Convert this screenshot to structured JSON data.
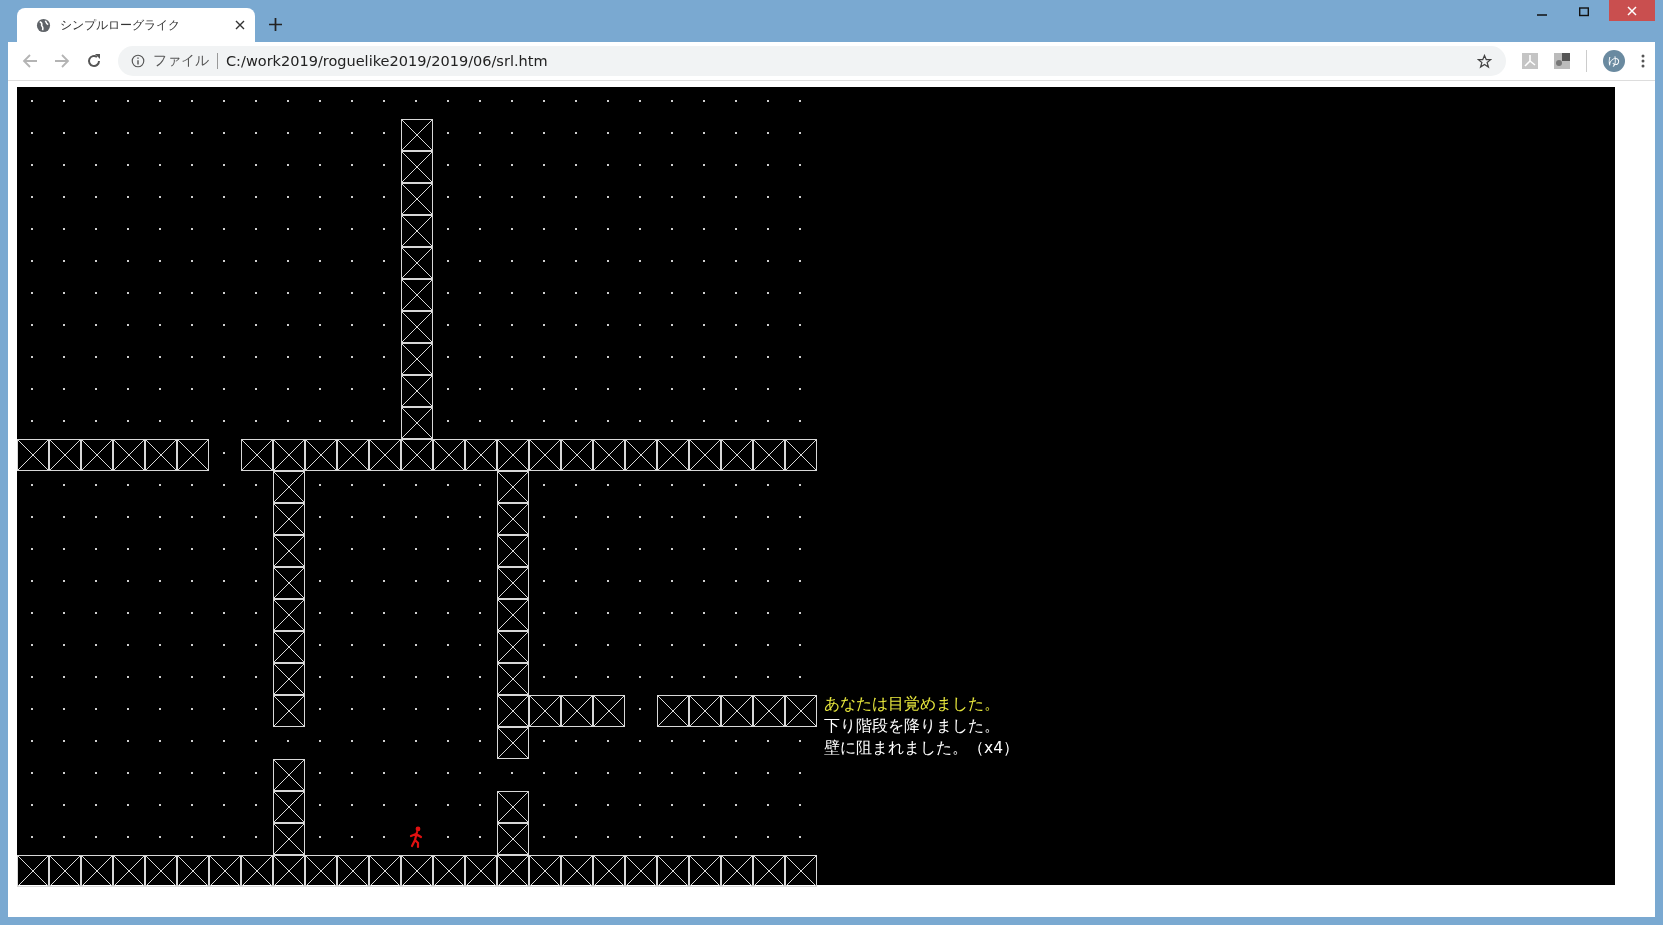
{
  "browser": {
    "tab": {
      "title": "シンプルローグライク"
    },
    "address": {
      "scheme": "ファイル",
      "url": "C:/work2019/roguelike2019/2019/06/srl.htm"
    },
    "avatar": "ゆ"
  },
  "map": {
    "rows": [
      [
        {
          "kind": "floor"
        },
        {
          "kind": "floor"
        },
        {
          "kind": "floor"
        },
        {
          "kind": "floor"
        },
        {
          "kind": "floor"
        },
        {
          "kind": "floor"
        },
        {
          "kind": "floor"
        },
        {
          "kind": "floor"
        },
        {
          "kind": "floor"
        },
        {
          "kind": "floor"
        },
        {
          "kind": "floor"
        },
        {
          "kind": "floor"
        },
        {
          "kind": "floor"
        },
        {
          "kind": "floor"
        },
        {
          "kind": "floor"
        },
        {
          "kind": "floor"
        },
        {
          "kind": "floor"
        },
        {
          "kind": "floor"
        },
        {
          "kind": "floor"
        },
        {
          "kind": "floor"
        },
        {
          "kind": "floor"
        },
        {
          "kind": "floor"
        },
        {
          "kind": "floor"
        },
        {
          "kind": "floor"
        },
        {
          "kind": "floor"
        }
      ],
      [
        {
          "kind": "floor"
        },
        {
          "kind": "floor"
        },
        {
          "kind": "floor"
        },
        {
          "kind": "floor"
        },
        {
          "kind": "floor"
        },
        {
          "kind": "floor"
        },
        {
          "kind": "floor"
        },
        {
          "kind": "floor"
        },
        {
          "kind": "floor"
        },
        {
          "kind": "floor"
        },
        {
          "kind": "floor"
        },
        {
          "kind": "floor"
        },
        {
          "kind": "wall"
        },
        {
          "kind": "floor"
        },
        {
          "kind": "floor"
        },
        {
          "kind": "floor"
        },
        {
          "kind": "floor"
        },
        {
          "kind": "floor"
        },
        {
          "kind": "floor"
        },
        {
          "kind": "floor"
        },
        {
          "kind": "floor"
        },
        {
          "kind": "floor"
        },
        {
          "kind": "floor"
        },
        {
          "kind": "floor"
        },
        {
          "kind": "floor"
        }
      ],
      [
        {
          "kind": "floor"
        },
        {
          "kind": "floor"
        },
        {
          "kind": "floor"
        },
        {
          "kind": "floor"
        },
        {
          "kind": "floor"
        },
        {
          "kind": "floor"
        },
        {
          "kind": "floor"
        },
        {
          "kind": "floor"
        },
        {
          "kind": "floor"
        },
        {
          "kind": "floor"
        },
        {
          "kind": "floor"
        },
        {
          "kind": "floor"
        },
        {
          "kind": "wall"
        },
        {
          "kind": "floor"
        },
        {
          "kind": "floor"
        },
        {
          "kind": "floor"
        },
        {
          "kind": "floor"
        },
        {
          "kind": "floor"
        },
        {
          "kind": "floor"
        },
        {
          "kind": "floor"
        },
        {
          "kind": "floor"
        },
        {
          "kind": "floor"
        },
        {
          "kind": "floor"
        },
        {
          "kind": "floor"
        },
        {
          "kind": "floor"
        }
      ],
      [
        {
          "kind": "floor"
        },
        {
          "kind": "floor"
        },
        {
          "kind": "floor"
        },
        {
          "kind": "floor"
        },
        {
          "kind": "floor"
        },
        {
          "kind": "floor"
        },
        {
          "kind": "floor"
        },
        {
          "kind": "floor"
        },
        {
          "kind": "floor"
        },
        {
          "kind": "floor"
        },
        {
          "kind": "floor"
        },
        {
          "kind": "floor"
        },
        {
          "kind": "wall"
        },
        {
          "kind": "floor"
        },
        {
          "kind": "floor"
        },
        {
          "kind": "floor"
        },
        {
          "kind": "floor"
        },
        {
          "kind": "floor"
        },
        {
          "kind": "floor"
        },
        {
          "kind": "floor"
        },
        {
          "kind": "floor"
        },
        {
          "kind": "floor"
        },
        {
          "kind": "floor"
        },
        {
          "kind": "floor"
        },
        {
          "kind": "floor"
        }
      ],
      [
        {
          "kind": "floor"
        },
        {
          "kind": "floor"
        },
        {
          "kind": "floor"
        },
        {
          "kind": "floor"
        },
        {
          "kind": "floor"
        },
        {
          "kind": "floor"
        },
        {
          "kind": "floor"
        },
        {
          "kind": "floor"
        },
        {
          "kind": "floor"
        },
        {
          "kind": "floor"
        },
        {
          "kind": "floor"
        },
        {
          "kind": "floor"
        },
        {
          "kind": "wall"
        },
        {
          "kind": "floor"
        },
        {
          "kind": "floor"
        },
        {
          "kind": "floor"
        },
        {
          "kind": "floor"
        },
        {
          "kind": "floor"
        },
        {
          "kind": "floor"
        },
        {
          "kind": "floor"
        },
        {
          "kind": "floor"
        },
        {
          "kind": "floor"
        },
        {
          "kind": "floor"
        },
        {
          "kind": "floor"
        },
        {
          "kind": "floor"
        }
      ],
      [
        {
          "kind": "floor"
        },
        {
          "kind": "floor"
        },
        {
          "kind": "floor"
        },
        {
          "kind": "floor"
        },
        {
          "kind": "floor"
        },
        {
          "kind": "floor"
        },
        {
          "kind": "floor"
        },
        {
          "kind": "floor"
        },
        {
          "kind": "floor"
        },
        {
          "kind": "floor"
        },
        {
          "kind": "floor"
        },
        {
          "kind": "floor"
        },
        {
          "kind": "wall"
        },
        {
          "kind": "floor"
        },
        {
          "kind": "floor"
        },
        {
          "kind": "floor"
        },
        {
          "kind": "floor"
        },
        {
          "kind": "floor"
        },
        {
          "kind": "floor"
        },
        {
          "kind": "floor"
        },
        {
          "kind": "floor"
        },
        {
          "kind": "floor"
        },
        {
          "kind": "floor"
        },
        {
          "kind": "floor"
        },
        {
          "kind": "floor"
        }
      ],
      [
        {
          "kind": "floor"
        },
        {
          "kind": "floor"
        },
        {
          "kind": "floor"
        },
        {
          "kind": "floor"
        },
        {
          "kind": "floor"
        },
        {
          "kind": "floor"
        },
        {
          "kind": "floor"
        },
        {
          "kind": "floor"
        },
        {
          "kind": "floor"
        },
        {
          "kind": "floor"
        },
        {
          "kind": "floor"
        },
        {
          "kind": "floor"
        },
        {
          "kind": "wall"
        },
        {
          "kind": "floor"
        },
        {
          "kind": "floor"
        },
        {
          "kind": "floor"
        },
        {
          "kind": "floor"
        },
        {
          "kind": "floor"
        },
        {
          "kind": "floor"
        },
        {
          "kind": "floor"
        },
        {
          "kind": "floor"
        },
        {
          "kind": "floor"
        },
        {
          "kind": "floor"
        },
        {
          "kind": "floor"
        },
        {
          "kind": "floor"
        }
      ],
      [
        {
          "kind": "floor"
        },
        {
          "kind": "floor"
        },
        {
          "kind": "floor"
        },
        {
          "kind": "floor"
        },
        {
          "kind": "floor"
        },
        {
          "kind": "floor"
        },
        {
          "kind": "floor"
        },
        {
          "kind": "floor"
        },
        {
          "kind": "floor"
        },
        {
          "kind": "floor"
        },
        {
          "kind": "floor"
        },
        {
          "kind": "floor"
        },
        {
          "kind": "wall"
        },
        {
          "kind": "floor"
        },
        {
          "kind": "floor"
        },
        {
          "kind": "floor"
        },
        {
          "kind": "floor"
        },
        {
          "kind": "floor"
        },
        {
          "kind": "floor"
        },
        {
          "kind": "floor"
        },
        {
          "kind": "floor"
        },
        {
          "kind": "floor"
        },
        {
          "kind": "floor"
        },
        {
          "kind": "floor"
        },
        {
          "kind": "floor"
        }
      ],
      [
        {
          "kind": "floor"
        },
        {
          "kind": "floor"
        },
        {
          "kind": "floor"
        },
        {
          "kind": "floor"
        },
        {
          "kind": "floor"
        },
        {
          "kind": "floor"
        },
        {
          "kind": "floor"
        },
        {
          "kind": "floor"
        },
        {
          "kind": "floor"
        },
        {
          "kind": "floor"
        },
        {
          "kind": "floor"
        },
        {
          "kind": "floor"
        },
        {
          "kind": "wall"
        },
        {
          "kind": "floor"
        },
        {
          "kind": "floor"
        },
        {
          "kind": "floor"
        },
        {
          "kind": "floor"
        },
        {
          "kind": "floor"
        },
        {
          "kind": "floor"
        },
        {
          "kind": "floor"
        },
        {
          "kind": "floor"
        },
        {
          "kind": "floor"
        },
        {
          "kind": "floor"
        },
        {
          "kind": "floor"
        },
        {
          "kind": "floor"
        }
      ],
      [
        {
          "kind": "floor"
        },
        {
          "kind": "floor"
        },
        {
          "kind": "floor"
        },
        {
          "kind": "floor"
        },
        {
          "kind": "floor"
        },
        {
          "kind": "floor"
        },
        {
          "kind": "floor"
        },
        {
          "kind": "floor"
        },
        {
          "kind": "floor"
        },
        {
          "kind": "floor"
        },
        {
          "kind": "floor"
        },
        {
          "kind": "floor"
        },
        {
          "kind": "wall"
        },
        {
          "kind": "floor"
        },
        {
          "kind": "floor"
        },
        {
          "kind": "floor"
        },
        {
          "kind": "floor"
        },
        {
          "kind": "floor"
        },
        {
          "kind": "floor"
        },
        {
          "kind": "floor"
        },
        {
          "kind": "floor"
        },
        {
          "kind": "floor"
        },
        {
          "kind": "floor"
        },
        {
          "kind": "floor"
        },
        {
          "kind": "floor"
        }
      ],
      [
        {
          "kind": "floor"
        },
        {
          "kind": "floor"
        },
        {
          "kind": "floor"
        },
        {
          "kind": "floor"
        },
        {
          "kind": "floor"
        },
        {
          "kind": "floor"
        },
        {
          "kind": "floor"
        },
        {
          "kind": "floor"
        },
        {
          "kind": "floor"
        },
        {
          "kind": "floor"
        },
        {
          "kind": "floor"
        },
        {
          "kind": "floor"
        },
        {
          "kind": "wall"
        },
        {
          "kind": "floor"
        },
        {
          "kind": "floor"
        },
        {
          "kind": "floor"
        },
        {
          "kind": "floor"
        },
        {
          "kind": "floor"
        },
        {
          "kind": "floor"
        },
        {
          "kind": "floor"
        },
        {
          "kind": "floor"
        },
        {
          "kind": "floor"
        },
        {
          "kind": "floor"
        },
        {
          "kind": "floor"
        },
        {
          "kind": "floor"
        }
      ],
      [
        {
          "kind": "wall"
        },
        {
          "kind": "wall"
        },
        {
          "kind": "wall"
        },
        {
          "kind": "wall"
        },
        {
          "kind": "wall"
        },
        {
          "kind": "wall"
        },
        {
          "kind": "floor"
        },
        {
          "kind": "wall"
        },
        {
          "kind": "wall"
        },
        {
          "kind": "wall"
        },
        {
          "kind": "wall"
        },
        {
          "kind": "wall"
        },
        {
          "kind": "wall"
        },
        {
          "kind": "wall"
        },
        {
          "kind": "wall"
        },
        {
          "kind": "wall"
        },
        {
          "kind": "wall"
        },
        {
          "kind": "wall"
        },
        {
          "kind": "wall"
        },
        {
          "kind": "wall"
        },
        {
          "kind": "wall"
        },
        {
          "kind": "wall"
        },
        {
          "kind": "wall"
        },
        {
          "kind": "wall"
        },
        {
          "kind": "wall"
        }
      ],
      [
        {
          "kind": "floor"
        },
        {
          "kind": "floor"
        },
        {
          "kind": "floor"
        },
        {
          "kind": "floor"
        },
        {
          "kind": "floor"
        },
        {
          "kind": "floor"
        },
        {
          "kind": "floor"
        },
        {
          "kind": "floor"
        },
        {
          "kind": "wall"
        },
        {
          "kind": "floor"
        },
        {
          "kind": "floor"
        },
        {
          "kind": "floor"
        },
        {
          "kind": "floor"
        },
        {
          "kind": "floor"
        },
        {
          "kind": "floor"
        },
        {
          "kind": "wall"
        },
        {
          "kind": "floor"
        },
        {
          "kind": "floor"
        },
        {
          "kind": "floor"
        },
        {
          "kind": "floor"
        },
        {
          "kind": "floor"
        },
        {
          "kind": "floor"
        },
        {
          "kind": "floor"
        },
        {
          "kind": "floor"
        },
        {
          "kind": "floor"
        }
      ],
      [
        {
          "kind": "floor"
        },
        {
          "kind": "floor"
        },
        {
          "kind": "floor"
        },
        {
          "kind": "floor"
        },
        {
          "kind": "floor"
        },
        {
          "kind": "floor"
        },
        {
          "kind": "floor"
        },
        {
          "kind": "floor"
        },
        {
          "kind": "wall"
        },
        {
          "kind": "floor"
        },
        {
          "kind": "floor"
        },
        {
          "kind": "floor"
        },
        {
          "kind": "floor"
        },
        {
          "kind": "floor"
        },
        {
          "kind": "floor"
        },
        {
          "kind": "wall"
        },
        {
          "kind": "floor"
        },
        {
          "kind": "floor"
        },
        {
          "kind": "floor"
        },
        {
          "kind": "floor"
        },
        {
          "kind": "floor"
        },
        {
          "kind": "floor"
        },
        {
          "kind": "floor"
        },
        {
          "kind": "floor"
        },
        {
          "kind": "floor"
        }
      ],
      [
        {
          "kind": "floor"
        },
        {
          "kind": "floor"
        },
        {
          "kind": "floor"
        },
        {
          "kind": "floor"
        },
        {
          "kind": "floor"
        },
        {
          "kind": "floor"
        },
        {
          "kind": "floor"
        },
        {
          "kind": "floor"
        },
        {
          "kind": "wall"
        },
        {
          "kind": "floor"
        },
        {
          "kind": "floor"
        },
        {
          "kind": "floor"
        },
        {
          "kind": "floor"
        },
        {
          "kind": "floor"
        },
        {
          "kind": "floor"
        },
        {
          "kind": "wall"
        },
        {
          "kind": "floor"
        },
        {
          "kind": "floor"
        },
        {
          "kind": "floor"
        },
        {
          "kind": "floor"
        },
        {
          "kind": "floor"
        },
        {
          "kind": "floor"
        },
        {
          "kind": "floor"
        },
        {
          "kind": "floor"
        },
        {
          "kind": "floor"
        }
      ],
      [
        {
          "kind": "floor"
        },
        {
          "kind": "floor"
        },
        {
          "kind": "floor"
        },
        {
          "kind": "floor"
        },
        {
          "kind": "floor"
        },
        {
          "kind": "floor"
        },
        {
          "kind": "floor"
        },
        {
          "kind": "floor"
        },
        {
          "kind": "wall"
        },
        {
          "kind": "floor"
        },
        {
          "kind": "floor"
        },
        {
          "kind": "floor"
        },
        {
          "kind": "floor"
        },
        {
          "kind": "floor"
        },
        {
          "kind": "floor"
        },
        {
          "kind": "wall"
        },
        {
          "kind": "floor"
        },
        {
          "kind": "floor"
        },
        {
          "kind": "floor"
        },
        {
          "kind": "floor"
        },
        {
          "kind": "floor"
        },
        {
          "kind": "floor"
        },
        {
          "kind": "floor"
        },
        {
          "kind": "floor"
        },
        {
          "kind": "floor"
        }
      ],
      [
        {
          "kind": "floor"
        },
        {
          "kind": "floor"
        },
        {
          "kind": "floor"
        },
        {
          "kind": "floor"
        },
        {
          "kind": "floor"
        },
        {
          "kind": "floor"
        },
        {
          "kind": "floor"
        },
        {
          "kind": "floor"
        },
        {
          "kind": "wall"
        },
        {
          "kind": "floor"
        },
        {
          "kind": "floor"
        },
        {
          "kind": "floor"
        },
        {
          "kind": "floor"
        },
        {
          "kind": "floor"
        },
        {
          "kind": "floor"
        },
        {
          "kind": "wall"
        },
        {
          "kind": "floor"
        },
        {
          "kind": "floor"
        },
        {
          "kind": "floor"
        },
        {
          "kind": "floor"
        },
        {
          "kind": "floor"
        },
        {
          "kind": "floor"
        },
        {
          "kind": "floor"
        },
        {
          "kind": "floor"
        },
        {
          "kind": "floor"
        }
      ],
      [
        {
          "kind": "floor"
        },
        {
          "kind": "floor"
        },
        {
          "kind": "floor"
        },
        {
          "kind": "floor"
        },
        {
          "kind": "floor"
        },
        {
          "kind": "floor"
        },
        {
          "kind": "floor"
        },
        {
          "kind": "floor"
        },
        {
          "kind": "wall"
        },
        {
          "kind": "floor"
        },
        {
          "kind": "floor"
        },
        {
          "kind": "floor"
        },
        {
          "kind": "floor"
        },
        {
          "kind": "floor"
        },
        {
          "kind": "floor"
        },
        {
          "kind": "wall"
        },
        {
          "kind": "floor"
        },
        {
          "kind": "floor"
        },
        {
          "kind": "floor"
        },
        {
          "kind": "floor"
        },
        {
          "kind": "floor"
        },
        {
          "kind": "floor"
        },
        {
          "kind": "floor"
        },
        {
          "kind": "floor"
        },
        {
          "kind": "floor"
        }
      ],
      [
        {
          "kind": "floor"
        },
        {
          "kind": "floor"
        },
        {
          "kind": "floor"
        },
        {
          "kind": "floor"
        },
        {
          "kind": "floor"
        },
        {
          "kind": "floor"
        },
        {
          "kind": "floor"
        },
        {
          "kind": "floor"
        },
        {
          "kind": "wall"
        },
        {
          "kind": "floor"
        },
        {
          "kind": "floor"
        },
        {
          "kind": "floor"
        },
        {
          "kind": "floor"
        },
        {
          "kind": "floor"
        },
        {
          "kind": "floor"
        },
        {
          "kind": "wall"
        },
        {
          "kind": "floor"
        },
        {
          "kind": "floor"
        },
        {
          "kind": "floor"
        },
        {
          "kind": "floor"
        },
        {
          "kind": "floor"
        },
        {
          "kind": "floor"
        },
        {
          "kind": "floor"
        },
        {
          "kind": "floor"
        },
        {
          "kind": "floor"
        }
      ],
      [
        {
          "kind": "floor"
        },
        {
          "kind": "floor"
        },
        {
          "kind": "floor"
        },
        {
          "kind": "floor"
        },
        {
          "kind": "floor"
        },
        {
          "kind": "floor"
        },
        {
          "kind": "floor"
        },
        {
          "kind": "floor"
        },
        {
          "kind": "wall"
        },
        {
          "kind": "floor"
        },
        {
          "kind": "floor"
        },
        {
          "kind": "floor"
        },
        {
          "kind": "floor"
        },
        {
          "kind": "floor"
        },
        {
          "kind": "floor"
        },
        {
          "kind": "wall"
        },
        {
          "kind": "wall"
        },
        {
          "kind": "wall"
        },
        {
          "kind": "wall"
        },
        {
          "kind": "floor"
        },
        {
          "kind": "wall"
        },
        {
          "kind": "wall"
        },
        {
          "kind": "wall"
        },
        {
          "kind": "wall"
        },
        {
          "kind": "wall"
        }
      ],
      [
        {
          "kind": "floor"
        },
        {
          "kind": "floor"
        },
        {
          "kind": "floor"
        },
        {
          "kind": "floor"
        },
        {
          "kind": "floor"
        },
        {
          "kind": "floor"
        },
        {
          "kind": "floor"
        },
        {
          "kind": "floor"
        },
        {
          "kind": "floor"
        },
        {
          "kind": "floor"
        },
        {
          "kind": "floor"
        },
        {
          "kind": "floor"
        },
        {
          "kind": "floor"
        },
        {
          "kind": "floor"
        },
        {
          "kind": "floor"
        },
        {
          "kind": "wall"
        },
        {
          "kind": "floor"
        },
        {
          "kind": "floor"
        },
        {
          "kind": "floor"
        },
        {
          "kind": "floor"
        },
        {
          "kind": "floor"
        },
        {
          "kind": "floor"
        },
        {
          "kind": "floor"
        },
        {
          "kind": "floor"
        },
        {
          "kind": "floor"
        }
      ],
      [
        {
          "kind": "floor"
        },
        {
          "kind": "floor"
        },
        {
          "kind": "floor"
        },
        {
          "kind": "floor"
        },
        {
          "kind": "floor"
        },
        {
          "kind": "floor"
        },
        {
          "kind": "floor"
        },
        {
          "kind": "floor"
        },
        {
          "kind": "wall"
        },
        {
          "kind": "floor"
        },
        {
          "kind": "floor"
        },
        {
          "kind": "floor"
        },
        {
          "kind": "floor"
        },
        {
          "kind": "floor"
        },
        {
          "kind": "floor"
        },
        {
          "kind": "floor"
        },
        {
          "kind": "floor"
        },
        {
          "kind": "floor"
        },
        {
          "kind": "floor"
        },
        {
          "kind": "floor"
        },
        {
          "kind": "floor"
        },
        {
          "kind": "floor"
        },
        {
          "kind": "floor"
        },
        {
          "kind": "floor"
        },
        {
          "kind": "floor"
        }
      ],
      [
        {
          "kind": "floor"
        },
        {
          "kind": "floor"
        },
        {
          "kind": "floor"
        },
        {
          "kind": "floor"
        },
        {
          "kind": "floor"
        },
        {
          "kind": "floor"
        },
        {
          "kind": "floor"
        },
        {
          "kind": "floor"
        },
        {
          "kind": "wall"
        },
        {
          "kind": "floor"
        },
        {
          "kind": "floor"
        },
        {
          "kind": "floor"
        },
        {
          "kind": "floor"
        },
        {
          "kind": "floor"
        },
        {
          "kind": "floor"
        },
        {
          "kind": "wall"
        },
        {
          "kind": "floor"
        },
        {
          "kind": "floor"
        },
        {
          "kind": "floor"
        },
        {
          "kind": "floor"
        },
        {
          "kind": "floor"
        },
        {
          "kind": "floor"
        },
        {
          "kind": "floor"
        },
        {
          "kind": "floor"
        },
        {
          "kind": "floor"
        }
      ],
      [
        {
          "kind": "floor"
        },
        {
          "kind": "floor"
        },
        {
          "kind": "floor"
        },
        {
          "kind": "floor"
        },
        {
          "kind": "floor"
        },
        {
          "kind": "floor"
        },
        {
          "kind": "floor"
        },
        {
          "kind": "floor"
        },
        {
          "kind": "wall"
        },
        {
          "kind": "floor"
        },
        {
          "kind": "floor"
        },
        {
          "kind": "floor"
        },
        {
          "kind": "hero"
        },
        {
          "kind": "floor"
        },
        {
          "kind": "floor"
        },
        {
          "kind": "wall"
        },
        {
          "kind": "floor"
        },
        {
          "kind": "floor"
        },
        {
          "kind": "floor"
        },
        {
          "kind": "floor"
        },
        {
          "kind": "floor"
        },
        {
          "kind": "floor"
        },
        {
          "kind": "floor"
        },
        {
          "kind": "floor"
        },
        {
          "kind": "floor"
        }
      ],
      [
        {
          "kind": "wall"
        },
        {
          "kind": "wall"
        },
        {
          "kind": "wall"
        },
        {
          "kind": "wall"
        },
        {
          "kind": "wall"
        },
        {
          "kind": "wall"
        },
        {
          "kind": "wall"
        },
        {
          "kind": "wall"
        },
        {
          "kind": "wall"
        },
        {
          "kind": "wall"
        },
        {
          "kind": "wall"
        },
        {
          "kind": "wall"
        },
        {
          "kind": "wall"
        },
        {
          "kind": "wall"
        },
        {
          "kind": "wall"
        },
        {
          "kind": "wall"
        },
        {
          "kind": "wall"
        },
        {
          "kind": "wall"
        },
        {
          "kind": "wall"
        },
        {
          "kind": "wall"
        },
        {
          "kind": "wall"
        },
        {
          "kind": "wall"
        },
        {
          "kind": "wall"
        },
        {
          "kind": "wall"
        },
        {
          "kind": "wall"
        }
      ]
    ]
  },
  "messages": [
    {
      "text": "あなたは目覚めました。",
      "color": "#e8e83c"
    },
    {
      "text": "下り階段を降りました。",
      "color": "#ffffff"
    },
    {
      "text": "壁に阻まれました。（x4）",
      "color": "#ffffff"
    }
  ]
}
